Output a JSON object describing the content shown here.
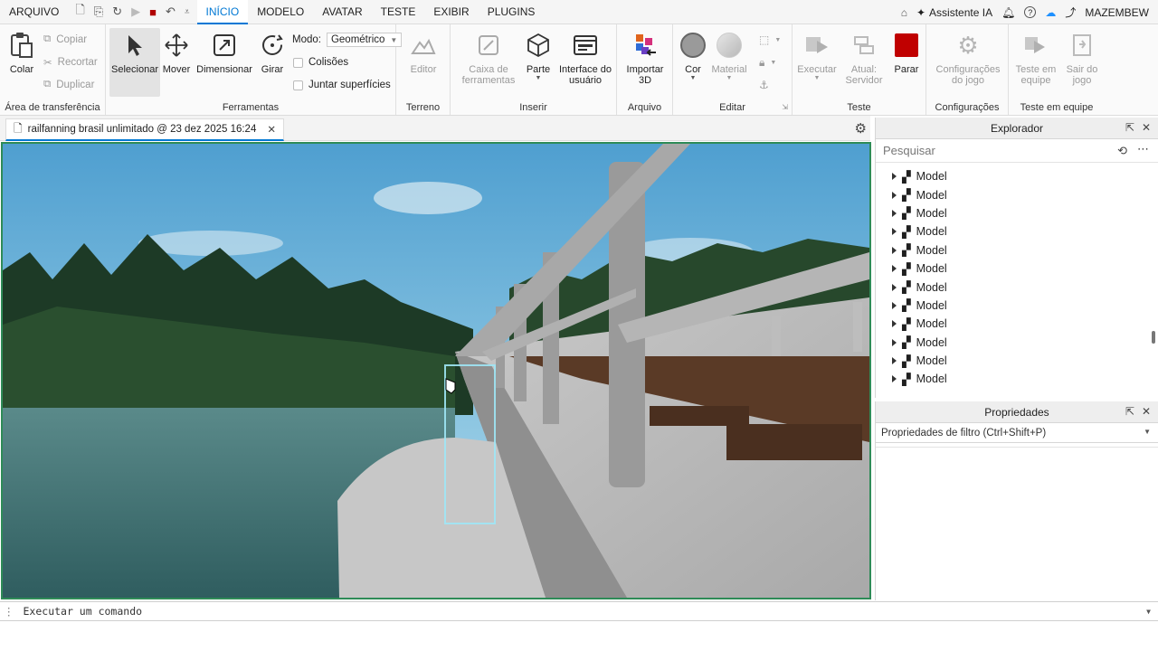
{
  "menu": {
    "items": [
      "ARQUIVO",
      "INÍCIO",
      "MODELO",
      "AVATAR",
      "TESTE",
      "EXIBIR",
      "PLUGINS"
    ],
    "active_index": 1,
    "assistant": "Assistente IA",
    "username": "MAZEMBEW"
  },
  "ribbon": {
    "clipboard": {
      "paste": "Colar",
      "copy": "Copiar",
      "cut": "Recortar",
      "duplicate": "Duplicar",
      "label": "Área de transferência"
    },
    "tools": {
      "select": "Selecionar",
      "move": "Mover",
      "scale": "Dimensionar",
      "rotate": "Girar",
      "mode_label": "Modo:",
      "mode_value": "Geométrico",
      "collisions": "Colisões",
      "join": "Juntar superfícies",
      "label": "Ferramentas"
    },
    "terrain": {
      "editor": "Editor",
      "label": "Terreno"
    },
    "insert": {
      "toolbox": "Caixa de ferramentas",
      "part": "Parte",
      "ui": "Interface do usuário",
      "label": "Inserir"
    },
    "file": {
      "import": "Importar 3D",
      "label": "Arquivo"
    },
    "edit": {
      "color": "Cor",
      "material": "Material",
      "label": "Editar"
    },
    "test": {
      "run": "Executar",
      "update": "Atual: Servidor",
      "stop": "Parar",
      "label": "Teste"
    },
    "settings": {
      "game_settings": "Configurações do jogo",
      "label": "Configurações"
    },
    "team": {
      "team_test": "Teste em equipe",
      "exit": "Sair do jogo",
      "label": "Teste em equipe"
    }
  },
  "document": {
    "tab_title": "railfanning brasil unlimitado @ 23 dez 2025 16:24"
  },
  "explorer": {
    "title": "Explorador",
    "search_placeholder": "Pesquisar",
    "items": [
      "Model",
      "Model",
      "Model",
      "Model",
      "Model",
      "Model",
      "Model",
      "Model",
      "Model",
      "Model",
      "Model",
      "Model"
    ]
  },
  "properties": {
    "title": "Propriedades",
    "filter_placeholder": "Propriedades de filtro (Ctrl+Shift+P)"
  },
  "command": {
    "placeholder": "Executar um comando"
  },
  "colors": {
    "accent": "#0078d4",
    "stop": "#c00000",
    "viewport_border": "#2e8b57"
  }
}
